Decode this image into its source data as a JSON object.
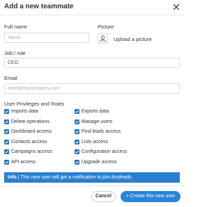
{
  "dialog": {
    "title": "Add a new teammate"
  },
  "form": {
    "full_name_label": "Full name",
    "full_name_placeholder": "Name",
    "picture_label": "Picture",
    "upload_label": "Upload a picture",
    "job_label": "Job / role",
    "job_value": "CEO",
    "email_label": "Email",
    "email_placeholder": "team@mycompany.com"
  },
  "privileges": {
    "heading": "User Privileges and Roles",
    "left": [
      {
        "label": "Imports data",
        "checked": true
      },
      {
        "label": "Delete operations",
        "checked": true
      },
      {
        "label": "Dashboard access",
        "checked": true
      },
      {
        "label": "Contacts access",
        "checked": true
      },
      {
        "label": "Campaigns access",
        "checked": true
      },
      {
        "label": "API access",
        "checked": true
      }
    ],
    "right": [
      {
        "label": "Exports data",
        "checked": true
      },
      {
        "label": "Manage users",
        "checked": true
      },
      {
        "label": "Find leads access",
        "checked": true
      },
      {
        "label": "Lists access",
        "checked": true
      },
      {
        "label": "Configuration access",
        "checked": true
      },
      {
        "label": "Upgrade access",
        "checked": true
      }
    ]
  },
  "info": {
    "tag": "Info",
    "message": " | This new user will get a notification to join Anyleads."
  },
  "buttons": {
    "cancel": "Cancel",
    "create": "+ Create this new user"
  },
  "colors": {
    "accent": "#2a84d8",
    "checkbox": "#2a73b5",
    "info_bg": "#2a7fd0"
  },
  "icons": {
    "close": "close-icon",
    "avatar": "user-avatar-icon",
    "checkbox": "checkbox-checked-icon"
  }
}
